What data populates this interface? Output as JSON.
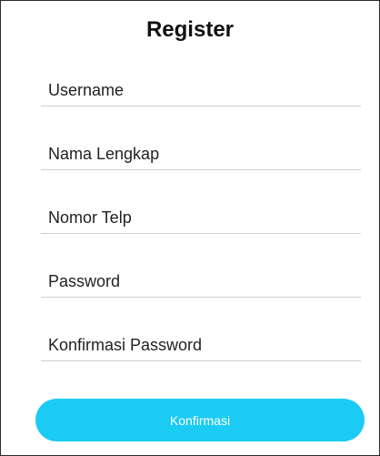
{
  "form": {
    "title": "Register",
    "fields": {
      "username": {
        "placeholder": "Username",
        "value": ""
      },
      "full_name": {
        "placeholder": "Nama Lengkap",
        "value": ""
      },
      "phone": {
        "placeholder": "Nomor Telp",
        "value": ""
      },
      "password": {
        "placeholder": "Password",
        "value": ""
      },
      "confirm_password": {
        "placeholder": "Konfirmasi Password",
        "value": ""
      }
    },
    "submit_label": "Konfirmasi"
  },
  "colors": {
    "accent": "#1ccbf3",
    "field_underline": "#cfcfcf",
    "text": "#222222",
    "frame_border": "#2b2b2b"
  }
}
